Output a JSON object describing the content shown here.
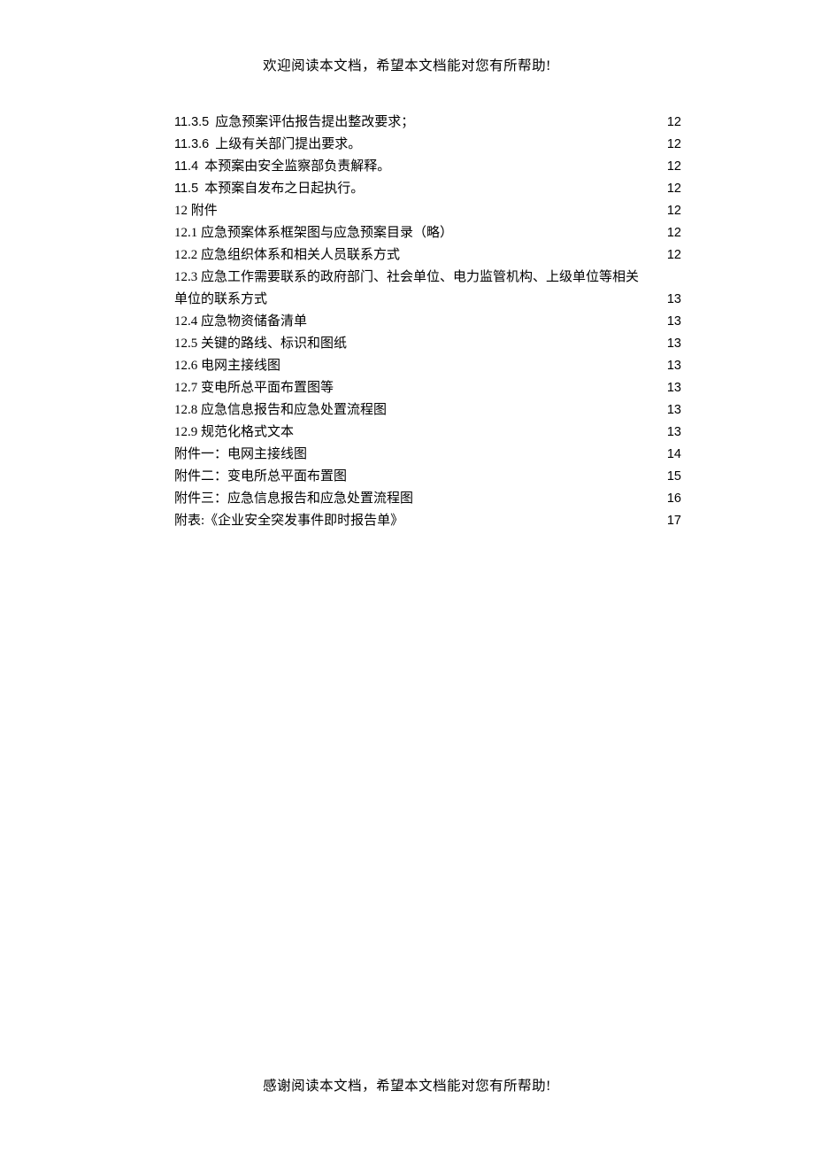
{
  "header": "欢迎阅读本文档，希望本文档能对您有所帮助!",
  "footer": "感谢阅读本文档，希望本文档能对您有所帮助!",
  "toc": [
    {
      "num": "11.3.5",
      "title": "应急预案评估报告提出整改要求；",
      "page": "12",
      "numClass": "num-mono"
    },
    {
      "num": "11.3.6",
      "title": "上级有关部门提出要求。",
      "page": "12",
      "numClass": "num-mono"
    },
    {
      "num": "11.4",
      "title": "本预案由安全监察部负责解释。",
      "page": "12",
      "numClass": "num-mono"
    },
    {
      "num": "11.5",
      "title": "本预案自发布之日起执行。",
      "page": "12",
      "numClass": "num-mono"
    },
    {
      "num": "12",
      "title": "附件",
      "page": "12",
      "numClass": "num-cn"
    },
    {
      "num": "12.1",
      "title": "应急预案体系框架图与应急预案目录（略）",
      "page": "12",
      "numClass": "num-cn"
    },
    {
      "num": "12.2",
      "title": "应急组织体系和相关人员联系方式",
      "page": "12",
      "numClass": "num-cn"
    },
    {
      "num": "12.3",
      "title": "应急工作需要联系的政府部门、社会单位、电力监管机构、上级单位等相关",
      "titleCont": "单位的联系方式",
      "page": "13",
      "numClass": "num-cn",
      "wrap": true
    },
    {
      "num": "12.4",
      "title": "应急物资储备清单",
      "page": "13",
      "numClass": "num-cn"
    },
    {
      "num": "12.5",
      "title": "关键的路线、标识和图纸",
      "page": "13",
      "numClass": "num-cn"
    },
    {
      "num": "12.6",
      "title": "电网主接线图",
      "page": "13",
      "numClass": "num-cn"
    },
    {
      "num": "12.7",
      "title": "变电所总平面布置图等",
      "page": "13",
      "numClass": "num-cn"
    },
    {
      "num": "12.8",
      "title": "应急信息报告和应急处置流程图",
      "page": "13",
      "numClass": "num-cn"
    },
    {
      "num": "12.9",
      "title": "规范化格式文本",
      "page": "13",
      "numClass": "num-cn"
    },
    {
      "num": "",
      "title": "附件一：电网主接线图",
      "page": "14",
      "numClass": ""
    },
    {
      "num": "",
      "title": "附件二：变电所总平面布置图",
      "page": "15",
      "numClass": ""
    },
    {
      "num": "",
      "title": "附件三：应急信息报告和应急处置流程图",
      "page": "16",
      "numClass": ""
    },
    {
      "num": "",
      "title": "附表:《企业安全突发事件即时报告单》",
      "page": "17",
      "numClass": ""
    }
  ]
}
